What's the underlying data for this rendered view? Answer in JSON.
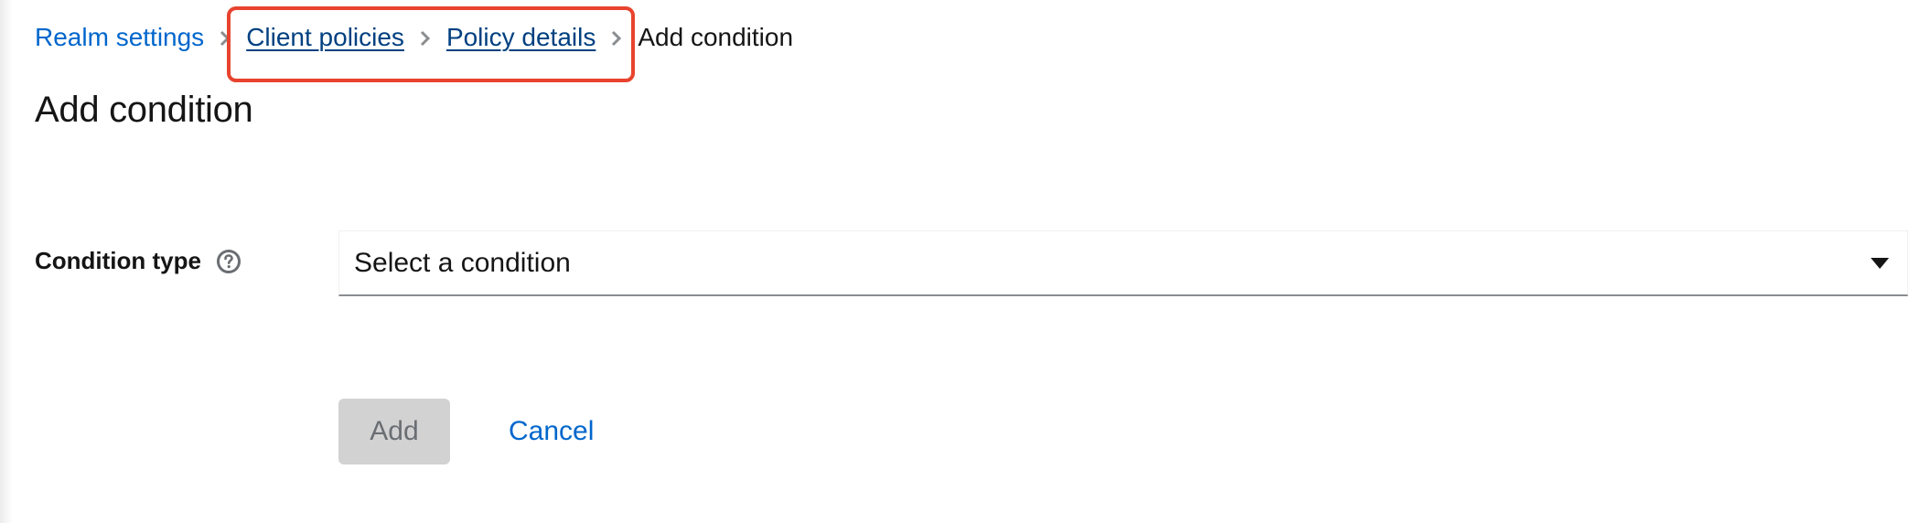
{
  "breadcrumb": {
    "items": [
      {
        "label": "Realm settings"
      },
      {
        "label": "Client policies"
      },
      {
        "label": "Policy details"
      }
    ],
    "current": "Add condition"
  },
  "page": {
    "title": "Add condition"
  },
  "form": {
    "condition_type_label": "Condition type",
    "condition_select_value": "Select a condition"
  },
  "actions": {
    "add_label": "Add",
    "cancel_label": "Cancel"
  },
  "colors": {
    "link": "#0066cc",
    "highlight": "#e8432e",
    "disabled_button": "#d2d2d2"
  }
}
